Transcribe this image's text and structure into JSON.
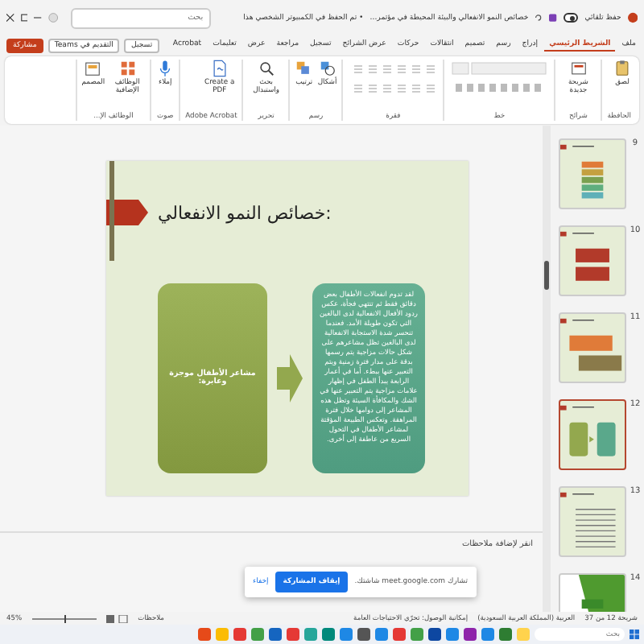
{
  "title_bar": {
    "autosave_label": "حفظ تلقائي",
    "autosave_on": false,
    "document_title": "خصائص النمو الانفعالي والبيئة المحيطة في مؤتمر...",
    "save_status": "• تم الحفظ في الكمبيوتر الشخصي هذا",
    "search": {
      "placeholder": "بحث"
    }
  },
  "tabs": [
    {
      "label": "ملف",
      "selected": false
    },
    {
      "label": "الشريط الرئيسي",
      "selected": true
    },
    {
      "label": "إدراج",
      "selected": false
    },
    {
      "label": "رسم",
      "selected": false
    },
    {
      "label": "تصميم",
      "selected": false
    },
    {
      "label": "انتقالات",
      "selected": false
    },
    {
      "label": "حركات",
      "selected": false
    },
    {
      "label": "عرض الشرائح",
      "selected": false
    },
    {
      "label": "تسجيل",
      "selected": false
    },
    {
      "label": "مراجعة",
      "selected": false
    },
    {
      "label": "عرض",
      "selected": false
    },
    {
      "label": "تعليمات",
      "selected": false
    },
    {
      "label": "Acrobat",
      "selected": false
    }
  ],
  "top_actions": [
    {
      "label": "تسجيل"
    },
    {
      "label": "التقديم في Teams"
    }
  ],
  "share_button": "مشاركة",
  "ribbon": [
    {
      "label": "الحافظة",
      "kind": "buttons",
      "buttons": [
        {
          "label": "لصق",
          "kind": "clipboard"
        }
      ]
    },
    {
      "label": "شرائح",
      "kind": "buttons",
      "buttons": [
        {
          "label": "شريحة جديدة",
          "kind": "slide"
        }
      ]
    },
    {
      "label": "خط",
      "kind": "font"
    },
    {
      "label": "فقرة",
      "kind": "paragraph"
    },
    {
      "label": "رسم",
      "kind": "buttons",
      "buttons": [
        {
          "label": "أشكال",
          "kind": "shapes"
        },
        {
          "label": "ترتيب",
          "kind": "arrange"
        }
      ]
    },
    {
      "label": "تحرير",
      "kind": "buttons",
      "buttons": [
        {
          "label": "بحث واستبدال",
          "kind": "search"
        }
      ]
    },
    {
      "label": "Adobe Acrobat",
      "kind": "buttons",
      "buttons": [
        {
          "label": "Create a PDF",
          "kind": "pdf"
        }
      ]
    },
    {
      "label": "صوت",
      "kind": "buttons",
      "buttons": [
        {
          "label": "إملاء",
          "kind": "mic"
        }
      ]
    },
    {
      "label": "الوظائف الإ...",
      "kind": "buttons",
      "buttons": [
        {
          "label": "الوظائف الإضافية",
          "kind": "grid"
        },
        {
          "label": "المصمم",
          "kind": "designer"
        }
      ]
    }
  ],
  "slide": {
    "title": "خصائص النمو الانفعالي:",
    "left_box": "مشاعر الأطفال موجزة وعابرة:",
    "right_box": "لقد تدوم انفعالات الأطفال بعض دقائق فقط ثم تنتهي فجأة، عكس ردود الأفعال الانفعالية لدى البالغين التي تكون طويلة الأمد. فعندما تنحسر شدة الاستجابة الانفعالية لدى البالغين تظل مشاعرهم على شكل حالات مزاجية يتم رسمها بدقة على مدار فترة زمنية ويتم التعبير عنها ببطء. أما في أعمار الرابعة يبدأ الطفل في إظهار علامات مزاجية يتم التعبير عنها في الشك والمكافأة السيئة وتظل هذه المشاعر إلى دوامها خلال فترة المراهقة. وتعكس الطبيعة المؤقتة لمشاعر الأطفال في التحول السريع من عاطفة إلى أخرى."
  },
  "thumbnails": [
    {
      "number": "9",
      "selected": false,
      "kind": "list"
    },
    {
      "number": "10",
      "selected": false,
      "kind": "boxes"
    },
    {
      "number": "11",
      "selected": false,
      "kind": "flow"
    },
    {
      "number": "12",
      "selected": true,
      "kind": "compare"
    },
    {
      "number": "13",
      "selected": false,
      "kind": "text"
    },
    {
      "number": "14",
      "selected": false,
      "kind": "green"
    }
  ],
  "notes": {
    "placeholder": "انقر لإضافة ملاحظات"
  },
  "share_popup": {
    "message": "تشارك meet.google.com شاشتك.",
    "stop_button": "إيقاف المشاركة",
    "hide_link": "إخفاء"
  },
  "status_bar": {
    "slide_count": "شريحة 12 من 37",
    "language": "العربية (المملكة العربية السعودية)",
    "accessibility": "إمكانية الوصول: تحرّي الاحتياجات العامة",
    "notes": "ملاحظات",
    "zoom": "45%",
    "zoom_level": {
      "level": 0.5
    }
  },
  "taskbar": {
    "search": {
      "placeholder": "بحث"
    }
  }
}
